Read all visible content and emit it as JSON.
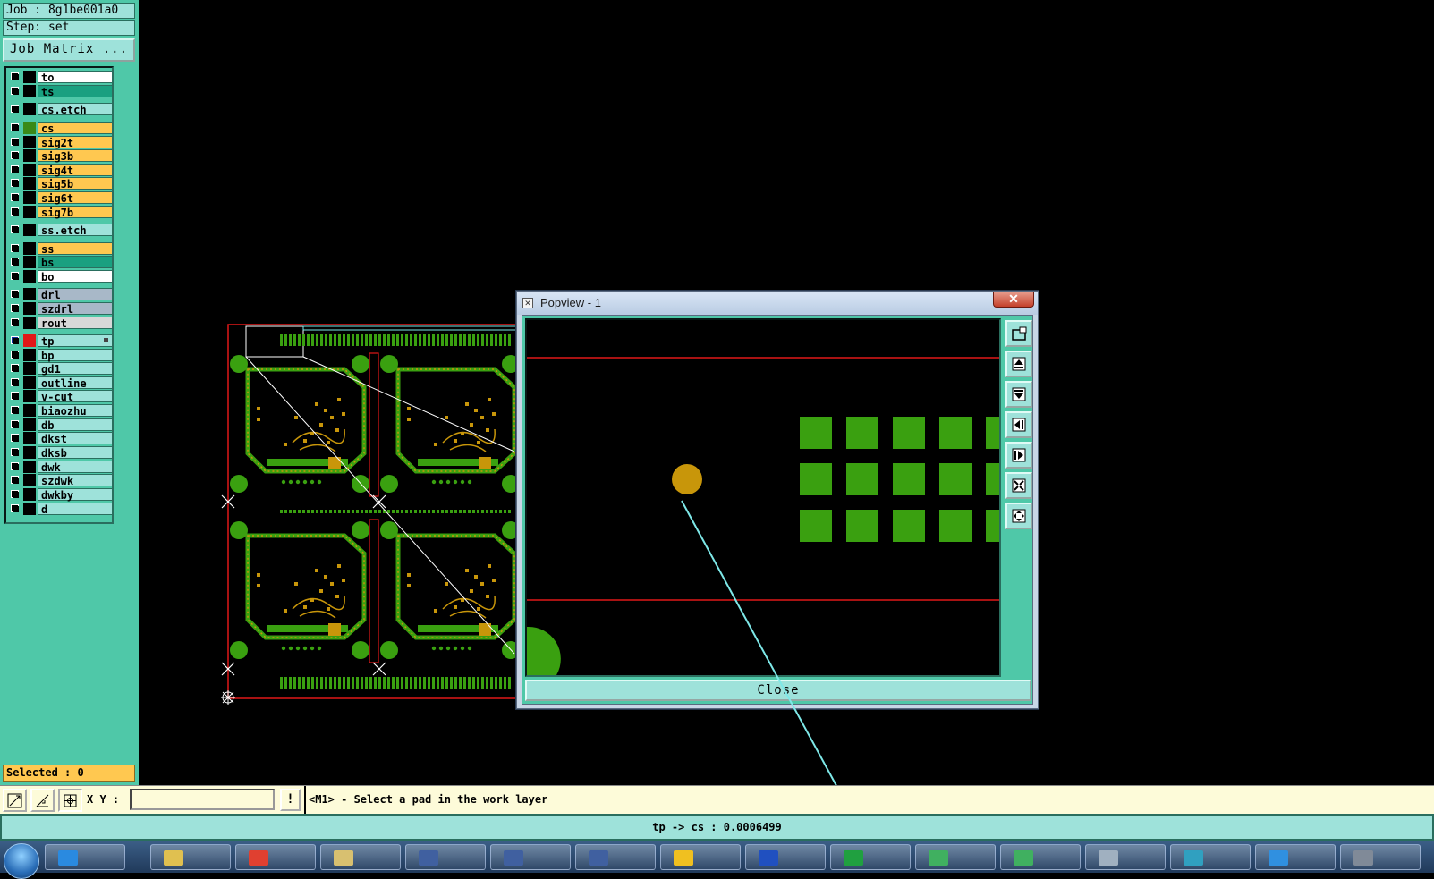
{
  "job": {
    "job_line": "Job : 8g1be001a0",
    "step_line": "Step: set",
    "matrix_button": "Job Matrix ..."
  },
  "layers": [
    {
      "name": "to",
      "color": "#ffffff",
      "swatch": "#000000"
    },
    {
      "name": "ts",
      "color": "#1aa080",
      "swatch": "#000000"
    },
    {
      "name": "cs.etch",
      "color": "#9ee2da",
      "swatch": "#000000"
    },
    {
      "name": "cs",
      "color": "#ffc850",
      "swatch": "#3a8a18"
    },
    {
      "name": "sig2t",
      "color": "#ffc850",
      "swatch": "#000000"
    },
    {
      "name": "sig3b",
      "color": "#ffc850",
      "swatch": "#000000"
    },
    {
      "name": "sig4t",
      "color": "#ffc850",
      "swatch": "#000000"
    },
    {
      "name": "sig5b",
      "color": "#ffc850",
      "swatch": "#000000"
    },
    {
      "name": "sig6t",
      "color": "#ffc850",
      "swatch": "#000000"
    },
    {
      "name": "sig7b",
      "color": "#ffc850",
      "swatch": "#000000"
    },
    {
      "name": "ss.etch",
      "color": "#9ee2da",
      "swatch": "#000000"
    },
    {
      "name": "ss",
      "color": "#ffc850",
      "swatch": "#000000"
    },
    {
      "name": "bs",
      "color": "#1aa080",
      "swatch": "#000000"
    },
    {
      "name": "bo",
      "color": "#ffffff",
      "swatch": "#000000"
    },
    {
      "name": "drl",
      "color": "#a8b8c8",
      "swatch": "#000000"
    },
    {
      "name": "szdrl",
      "color": "#a8b8c8",
      "swatch": "#000000"
    },
    {
      "name": "rout",
      "color": "#d8d8d8",
      "swatch": "#000000"
    },
    {
      "name": "tp",
      "color": "#9ee2da",
      "swatch": "#e01818",
      "work": true
    },
    {
      "name": "bp",
      "color": "#9ee2da",
      "swatch": "#000000"
    },
    {
      "name": "gd1",
      "color": "#9ee2da",
      "swatch": "#000000"
    },
    {
      "name": "outline",
      "color": "#9ee2da",
      "swatch": "#000000"
    },
    {
      "name": "v-cut",
      "color": "#9ee2da",
      "swatch": "#000000"
    },
    {
      "name": "biaozhu",
      "color": "#9ee2da",
      "swatch": "#000000"
    },
    {
      "name": "db",
      "color": "#9ee2da",
      "swatch": "#000000"
    },
    {
      "name": "dkst",
      "color": "#9ee2da",
      "swatch": "#000000"
    },
    {
      "name": "dksb",
      "color": "#9ee2da",
      "swatch": "#000000"
    },
    {
      "name": "dwk",
      "color": "#9ee2da",
      "swatch": "#000000"
    },
    {
      "name": "szdwk",
      "color": "#9ee2da",
      "swatch": "#000000"
    },
    {
      "name": "dwkby",
      "color": "#9ee2da",
      "swatch": "#000000"
    },
    {
      "name": "d",
      "color": "#9ee2da",
      "swatch": "#000000"
    }
  ],
  "selected": "Selected : 0",
  "popview": {
    "title": "Popview - 1",
    "close_x": "✕",
    "close_button": "Close",
    "tools": [
      "zoom-window-icon",
      "pan-up-icon",
      "pan-down-icon",
      "pan-left-icon",
      "pan-right-icon",
      "zoom-fit-icon",
      "zoom-home-icon"
    ]
  },
  "command_bar": {
    "xy_label": "X Y :",
    "xy_value": "",
    "warn_label": "!",
    "prompt": "<M1> - Select a pad in the work layer"
  },
  "status": "tp -> cs : 0.0006499",
  "colors": {
    "panel": "#4fc8a8",
    "panel_light": "#9ee2da",
    "signal": "#ffc850",
    "copper_green": "#3aa010",
    "pad_gold": "#c8960a",
    "outline_red": "#e01818",
    "measure_cyan": "#7ee8e8"
  },
  "taskbar": {
    "items": [
      {
        "icon": "ie-icon",
        "color": "#2a8ae0"
      },
      {
        "icon": "explorer-icon",
        "color": "#e0c050"
      },
      {
        "icon": "app-red-icon",
        "color": "#e04030"
      },
      {
        "icon": "folder-icon",
        "color": "#d8c070"
      },
      {
        "icon": "window-icon",
        "color": "#4060a0"
      },
      {
        "icon": "window-icon",
        "color": "#4060a0"
      },
      {
        "icon": "window-icon",
        "color": "#4060a0"
      },
      {
        "icon": "sun-icon",
        "color": "#f0c020"
      },
      {
        "icon": "app-blue-icon",
        "color": "#2050c0"
      },
      {
        "icon": "excel-icon",
        "color": "#20a040"
      },
      {
        "icon": "spreadsheet-icon",
        "color": "#40b060"
      },
      {
        "icon": "spreadsheet-icon",
        "color": "#40b060"
      },
      {
        "icon": "doc-icon",
        "color": "#a0b0c0"
      },
      {
        "icon": "network-icon",
        "color": "#30a0c0"
      },
      {
        "icon": "messenger-icon",
        "color": "#3090e0"
      },
      {
        "icon": "window-icon",
        "color": "#808a98"
      }
    ]
  }
}
